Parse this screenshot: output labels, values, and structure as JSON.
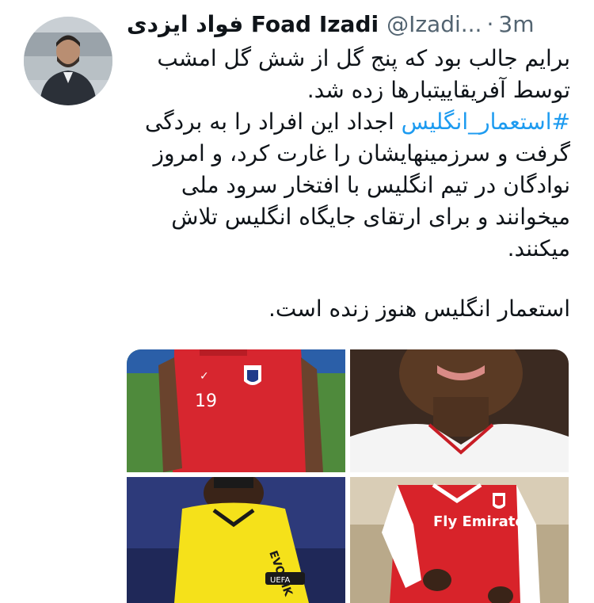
{
  "tweet": {
    "author_name": "فواد ایزدی Foad Izadi",
    "handle": "@Izadi...",
    "separator": "·",
    "time": "3m",
    "lines": [
      {
        "text": "برایم جالب بود که پنج گل از شش گل امشب"
      },
      {
        "text": "توسط آفریقاییتبارها زده شد."
      },
      {
        "hashtag": "#استعمار_انگلیس",
        "text": " اجداد این افراد را به بردگی"
      },
      {
        "text": "گرفت و سرزمینهایشان را غارت کرد، و امروز"
      },
      {
        "text": "نوادگان در تیم انگلیس با افتخار سرود ملی"
      },
      {
        "text": "میخوانند و برای ارتقای جایگاه انگلیس تلاش"
      },
      {
        "text": "میکنند."
      }
    ],
    "closing_line": "استعمار انگلیس هنوز زنده است."
  },
  "media": {
    "photos": [
      {
        "name": "england-19-shirt",
        "jersey_number": "19",
        "brand": "✓"
      },
      {
        "name": "player-closeup",
        "colors": [
          "#5a3a24",
          "#f4f4f4"
        ]
      },
      {
        "name": "yellow-kit-player",
        "sponsor_text": "EVONIK",
        "badge_text": "UEFA"
      },
      {
        "name": "arsenal-kit-player",
        "sponsor_text": "Fly Emirates"
      }
    ]
  },
  "colors": {
    "hashtag": "#1d9bf0",
    "secondary_text": "#536471",
    "england_red": "#d7262f",
    "arsenal_red": "#d8232a",
    "dortmund_yellow": "#f5e11a"
  },
  "icons": {
    "avatar": "profile-photo"
  }
}
